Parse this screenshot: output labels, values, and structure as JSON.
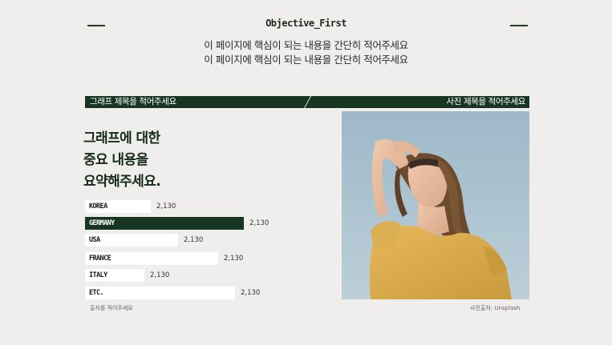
{
  "header": {
    "title": "Objective_First",
    "subtitle_line1": "이 페이지에 핵심이 되는 내용을 간단히 적어주세요",
    "subtitle_line2": "이 페이지에 핵심이 되는 내용을 간단히 적어주세요"
  },
  "left_panel": {
    "bar_title": "그래프 제목을 적어주세요",
    "headline": [
      "그래프에 대한",
      "중요 내용을",
      "요약해주세요."
    ],
    "source": "출처를 적어주세요"
  },
  "right_panel": {
    "bar_title": "사진 제목을 적어주세요",
    "photo_credit": "사진출처:  Unsplash"
  },
  "colors": {
    "background": "#efeeec",
    "accent": "#173622",
    "bar": "#ffffff"
  },
  "chart_data": {
    "type": "bar",
    "orientation": "horizontal",
    "categories": [
      "KOREA",
      "GERMANY",
      "USA",
      "FRANCE",
      "ITALY",
      "ETC."
    ],
    "values": [
      2130,
      2130,
      2130,
      2130,
      2130,
      2130
    ],
    "value_labels": [
      "2,130",
      "2,130",
      "2,130",
      "2,130",
      "2,130",
      "2,130"
    ],
    "highlight": "GERMANY"
  }
}
